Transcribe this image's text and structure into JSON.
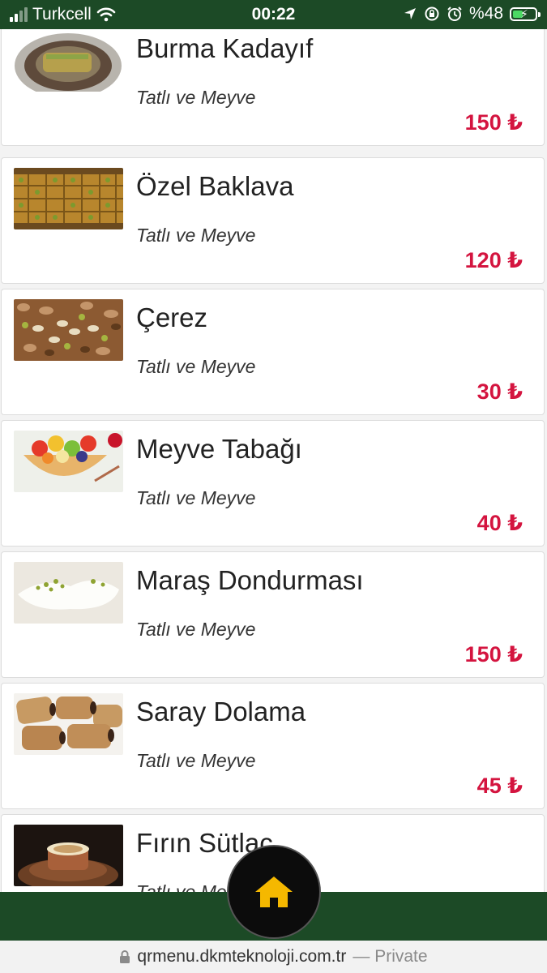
{
  "status_bar": {
    "carrier": "Turkcell",
    "time": "00:22",
    "battery": "%48",
    "battery_level": 0.48,
    "icons": [
      "signal-icon",
      "wifi-icon",
      "location-icon",
      "rotation-lock-icon",
      "alarm-icon",
      "battery-charging-icon"
    ]
  },
  "menu": {
    "items": [
      {
        "name": "Burma Kadayıf",
        "category": "Tatlı ve Meyve",
        "price": "150 ₺"
      },
      {
        "name": "Özel Baklava",
        "category": "Tatlı ve Meyve",
        "price": "120 ₺"
      },
      {
        "name": "Çerez",
        "category": "Tatlı ve Meyve",
        "price": "30 ₺"
      },
      {
        "name": "Meyve Tabağı",
        "category": "Tatlı ve Meyve",
        "price": "40 ₺"
      },
      {
        "name": "Maraş Dondurması",
        "category": "Tatlı ve Meyve",
        "price": "150 ₺"
      },
      {
        "name": "Saray Dolama",
        "category": "Tatlı ve Meyve",
        "price": "45 ₺"
      },
      {
        "name": "Fırın Sütlaç",
        "category": "Tatlı ve Meyve",
        "price": ""
      }
    ]
  },
  "nav": {
    "home_icon": "home-icon"
  },
  "browser": {
    "url": "qrmenu.dkmteknoloji.com.tr",
    "mode": "— Private"
  },
  "colors": {
    "brand_green": "#1c4a26",
    "price_red": "#d4143f",
    "home_yellow": "#f5b800"
  }
}
